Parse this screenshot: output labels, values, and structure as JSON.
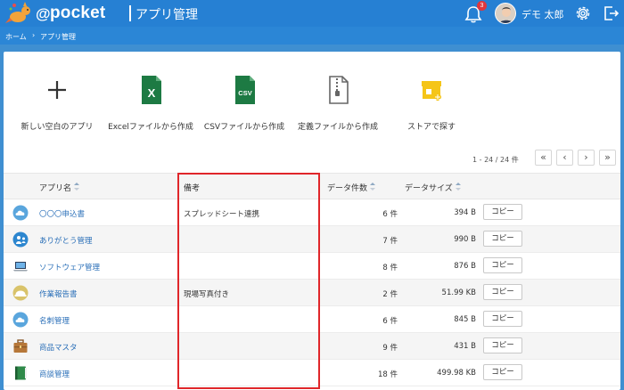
{
  "header": {
    "logo_at": "@",
    "logo_text": "pocket",
    "title": "アプリ管理",
    "notification_count": "3",
    "username": "デモ 太郎"
  },
  "breadcrumb": {
    "home": "ホーム",
    "separator": "›",
    "current": "アプリ管理"
  },
  "create": {
    "tiles": [
      {
        "label": "新しい空白のアプリ",
        "icon": "plus-icon"
      },
      {
        "label": "Excelファイルから作成",
        "icon": "excel-file-icon",
        "badge": "X"
      },
      {
        "label": "CSVファイルから作成",
        "icon": "csv-file-icon",
        "badge": "CSV"
      },
      {
        "label": "定義ファイルから作成",
        "icon": "zip-file-icon"
      },
      {
        "label": "ストアで探す",
        "icon": "store-icon"
      }
    ]
  },
  "pager": {
    "info": "1 - 24 / 24 件",
    "first": "«",
    "prev": "‹",
    "next": "›",
    "last": "»"
  },
  "table": {
    "columns": {
      "name": "アプリ名",
      "note": "備考",
      "count": "データ件数",
      "size": "データサイズ"
    },
    "copy_label": "コピー",
    "rows": [
      {
        "icon": "cloud-icon",
        "name": "〇〇〇申込書",
        "note": "スプレッドシート連携",
        "count": "6 件",
        "size": "394 B"
      },
      {
        "icon": "thanks-icon",
        "name": "ありがとう管理",
        "note": "",
        "count": "7 件",
        "size": "990 B"
      },
      {
        "icon": "laptop-icon",
        "name": "ソフトウェア管理",
        "note": "",
        "count": "8 件",
        "size": "876 B"
      },
      {
        "icon": "helmet-icon",
        "name": "作業報告書",
        "note": "現場写真付き",
        "count": "2 件",
        "size": "51.99 KB"
      },
      {
        "icon": "cloud-icon",
        "name": "名刺管理",
        "note": "",
        "count": "6 件",
        "size": "845 B"
      },
      {
        "icon": "briefcase-icon",
        "name": "商品マスタ",
        "note": "",
        "count": "9 件",
        "size": "431 B"
      },
      {
        "icon": "notebook-icon",
        "name": "商談管理",
        "note": "",
        "count": "18 件",
        "size": "499.98 KB"
      }
    ]
  },
  "colors": {
    "header_bg": "#2680d3",
    "link": "#2a6fb8",
    "highlight": "#e0262a",
    "excel": "#1d7a43",
    "store": "#f5c518"
  }
}
